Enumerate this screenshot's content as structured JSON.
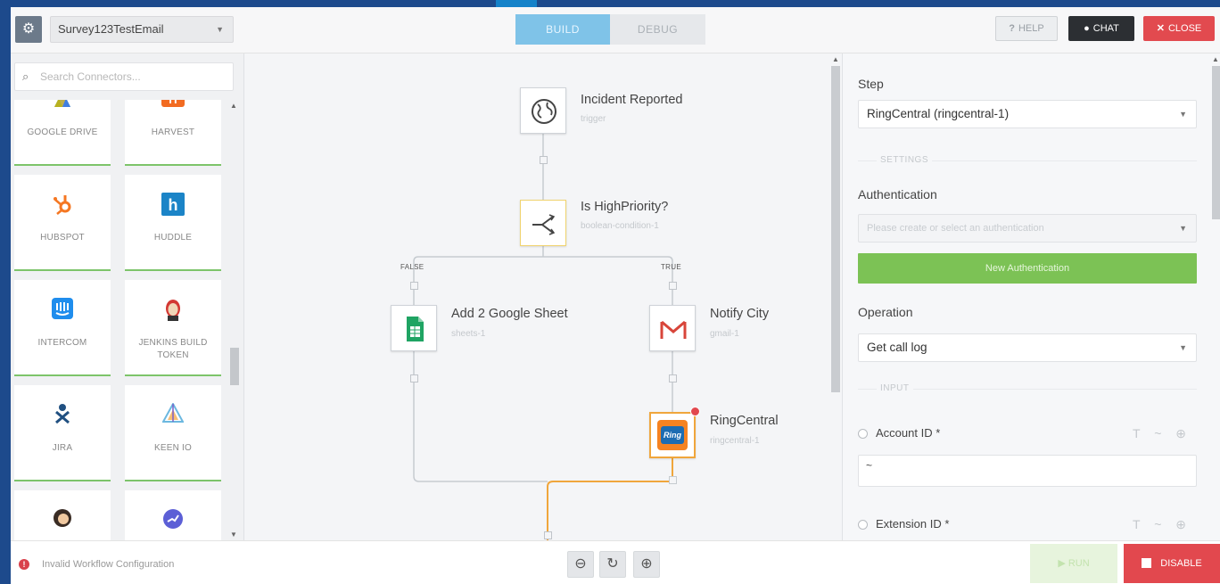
{
  "header": {
    "workflow_name": "Survey123TestEmail",
    "tabs": [
      {
        "label": "BUILD",
        "active": true
      },
      {
        "label": "DEBUG",
        "active": false
      }
    ],
    "help_label": "HELP",
    "chat_label": "CHAT",
    "close_label": "CLOSE"
  },
  "sidebar": {
    "search_placeholder": "Search Connectors...",
    "connectors": [
      {
        "label": "GOOGLE DRIVE",
        "icon": "google-drive-icon"
      },
      {
        "label": "HARVEST",
        "icon": "harvest-icon"
      },
      {
        "label": "HUBSPOT",
        "icon": "hubspot-icon"
      },
      {
        "label": "HUDDLE",
        "icon": "huddle-icon"
      },
      {
        "label": "INTERCOM",
        "icon": "intercom-icon"
      },
      {
        "label": "JENKINS BUILD TOKEN",
        "icon": "jenkins-icon"
      },
      {
        "label": "JIRA",
        "icon": "jira-icon"
      },
      {
        "label": "KEEN IO",
        "icon": "keen-io-icon"
      },
      {
        "label": "",
        "icon": "mascot-icon"
      },
      {
        "label": "",
        "icon": "chart-circle-icon"
      }
    ]
  },
  "canvas": {
    "nodes": [
      {
        "title": "Incident Reported",
        "subtitle": "trigger",
        "icon": "globe-icon"
      },
      {
        "title": "Is HighPriority?",
        "subtitle": "boolean-condition-1",
        "icon": "split-icon"
      },
      {
        "title": "Add 2 Google Sheet",
        "subtitle": "sheets-1",
        "icon": "google-sheets-icon"
      },
      {
        "title": "Notify City",
        "subtitle": "gmail-1",
        "icon": "gmail-icon"
      },
      {
        "title": "RingCentral",
        "subtitle": "ringcentral-1",
        "icon": "ringcentral-icon"
      }
    ],
    "branch_false": "FALSE",
    "branch_true": "TRUE",
    "ringcentral_badge": "Ring"
  },
  "panel": {
    "step_label": "Step",
    "step_value": "RingCentral (ringcentral-1)",
    "settings_label": "SETTINGS",
    "auth_label": "Authentication",
    "auth_placeholder": "Please create or select an authentication",
    "new_auth_label": "New Authentication",
    "operation_label": "Operation",
    "operation_value": "Get call log",
    "input_label": "INPUT",
    "fields": [
      {
        "label": "Account ID *",
        "value": "~"
      },
      {
        "label": "Extension ID *",
        "value": ""
      }
    ],
    "field_tools": "T ~ ⊕"
  },
  "footer": {
    "error_text": "Invalid Workflow Configuration",
    "run_label": "RUN",
    "disable_label": "DISABLE"
  },
  "colors": {
    "accent_blue": "#7fc3e8",
    "success_green": "#7cc255",
    "danger_red": "#e24a4f",
    "active_path_orange": "#f0a63c"
  }
}
